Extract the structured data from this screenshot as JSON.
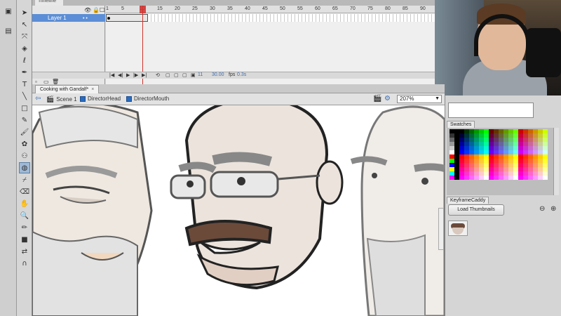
{
  "timeline": {
    "panel_tab": "Timeline",
    "layer_name": "Layer 1",
    "ruler_ticks": [
      "1",
      "5",
      "10",
      "15",
      "20",
      "25",
      "30",
      "35",
      "40",
      "45",
      "50",
      "55",
      "60",
      "65",
      "70",
      "75",
      "80",
      "85",
      "90"
    ],
    "controls": {
      "current_frame": "11",
      "fps": "30.00",
      "fps_unit": "fps",
      "elapsed": "0.3s"
    }
  },
  "document": {
    "tab_label": "Cooking with Gandalf*",
    "close_glyph": "×",
    "breadcrumbs": [
      "Scene 1",
      "DirectorHead",
      "DirectorMouth"
    ],
    "zoom": "207%"
  },
  "panels": {
    "swatches_tab": "Swatches",
    "keyframe_tab": "KeyframeCaddy",
    "load_button": "Load Thumbnails"
  },
  "tools": [
    "selection-icon",
    "subselection-icon",
    "free-transform-icon",
    "gradient-icon",
    "lasso-icon",
    "pen-icon",
    "text-icon",
    "line-icon",
    "rectangle-icon",
    "pencil-icon",
    "brush-icon",
    "deco-icon",
    "bone-icon",
    "paint-bucket-icon",
    "eyedropper-icon",
    "eraser-icon",
    "hand-icon",
    "zoom-icon",
    "stroke-color-icon",
    "fill-color-icon",
    "swap-colors-icon",
    "snap-icon"
  ],
  "colors": {
    "accent": "#5b8ed6",
    "playhead": "#d0312d"
  }
}
